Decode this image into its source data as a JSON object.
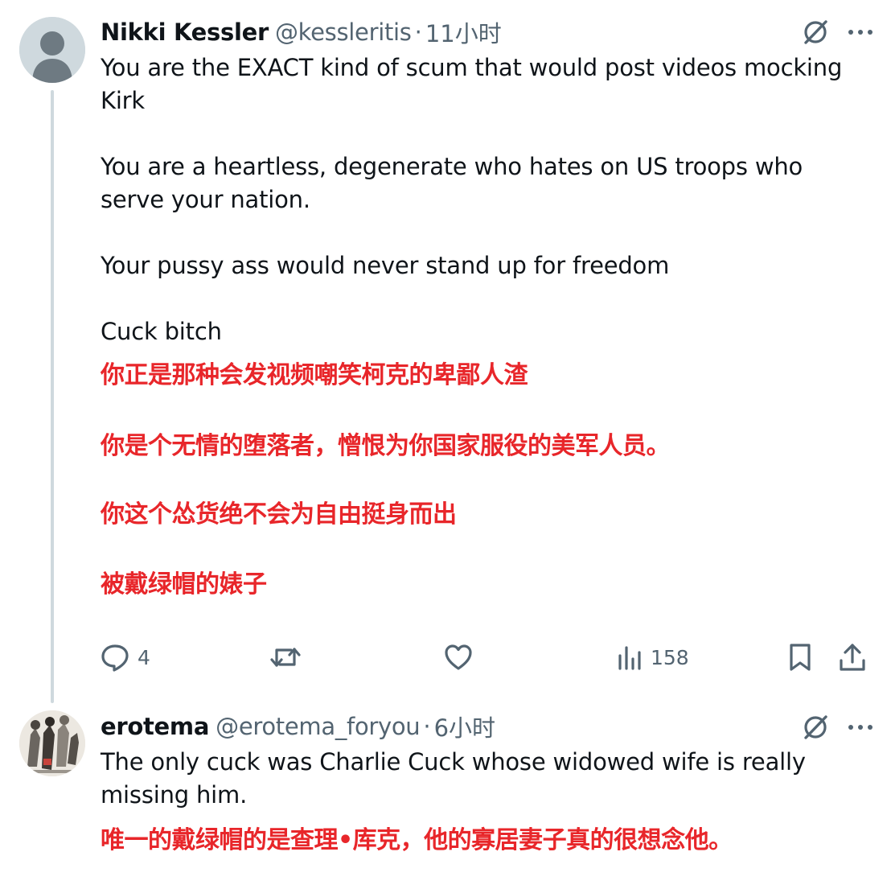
{
  "tweets": [
    {
      "display_name": "Nikki Kessler",
      "handle": "@kessleritis",
      "separator": "·",
      "time": "11小时",
      "avatar_icon": "default-avatar-silhouette",
      "body": [
        "You are the EXACT kind of scum that would post videos mocking Kirk",
        "",
        "You are a heartless, degenerate who hates on US troops who serve your nation.",
        "",
        "Your pussy ass would never stand up for freedom",
        "",
        "Cuck bitch"
      ],
      "translation": [
        "你正是那种会发视频嘲笑柯克的卑鄙人渣",
        "你是个无情的堕落者，憎恨为你国家服役的美军人员。",
        "你这个怂货绝不会为自由挺身而出",
        "被戴绿帽的婊子"
      ],
      "actions": {
        "reply_count": "4",
        "retweet_count": "",
        "like_count": "",
        "views_count": "158"
      }
    },
    {
      "display_name": "erotema",
      "handle": "@erotema_foryou",
      "separator": "·",
      "time": "6小时",
      "avatar_icon": "artwork-avatar",
      "body": [
        "The only cuck was Charlie Cuck whose widowed wife is really missing him."
      ],
      "translation": [
        "唯一的戴绿帽的是查理•库克，他的寡居妻子真的很想念他。"
      ]
    }
  ],
  "colors": {
    "text": "#0f1419",
    "secondary": "#536471",
    "thread_line": "#cfd9de",
    "translation": "#e8262a"
  },
  "icons": [
    "grok-icon",
    "more-icon",
    "reply-icon",
    "retweet-icon",
    "like-icon",
    "views-icon",
    "bookmark-icon",
    "share-icon"
  ]
}
